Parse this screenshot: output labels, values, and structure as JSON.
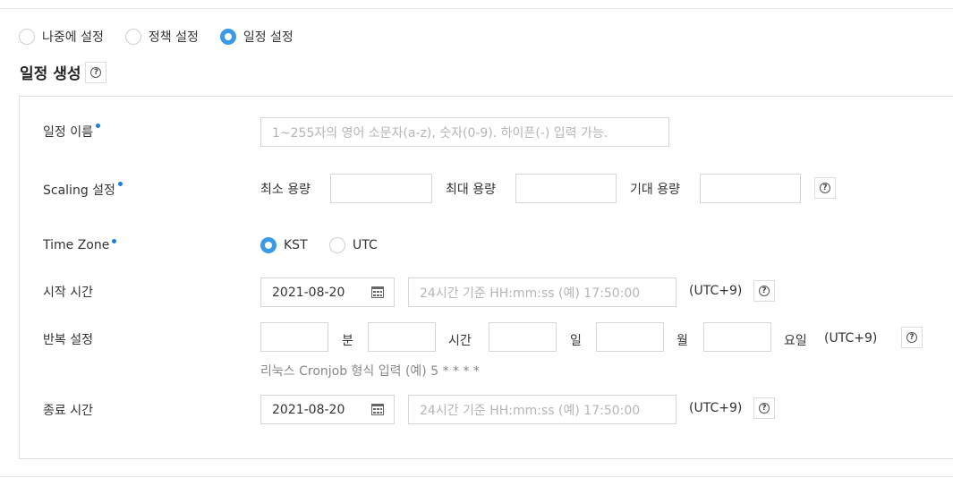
{
  "mode_options": [
    {
      "label": "나중에 설정",
      "selected": false
    },
    {
      "label": "정책 설정",
      "selected": false
    },
    {
      "label": "일정 설정",
      "selected": true
    }
  ],
  "section": {
    "title": "일정 생성"
  },
  "form": {
    "name": {
      "label": "일정 이름",
      "placeholder": "1~255자의 영어 소문자(a-z), 숫자(0-9). 하이픈(-) 입력 가능."
    },
    "scaling": {
      "label": "Scaling 설정",
      "min_label": "최소 용량",
      "max_label": "최대 용량",
      "desired_label": "기대 용량"
    },
    "timezone": {
      "label": "Time Zone",
      "options": [
        {
          "label": "KST",
          "selected": true
        },
        {
          "label": "UTC",
          "selected": false
        }
      ]
    },
    "start": {
      "label": "시작 시간",
      "date": "2021-08-20",
      "time_placeholder": "24시간 기준 HH:mm:ss (예) 17:50:00",
      "utc_note": "(UTC+9)"
    },
    "repeat": {
      "label": "반복 설정",
      "minute_label": "분",
      "hour_label": "시간",
      "day_label": "일",
      "month_label": "월",
      "weekday_label": "요일",
      "utc_note": "(UTC+9)",
      "hint": "리눅스 Cronjob 형식 입력 (예) 5 * * * *"
    },
    "end": {
      "label": "종료 시간",
      "date": "2021-08-20",
      "time_placeholder": "24시간 기준 HH:mm:ss (예) 17:50:00",
      "utc_note": "(UTC+9)"
    }
  },
  "colors": {
    "accent": "#3a9ae8",
    "required_dot": "#1e7be0",
    "border": "#d6d6d6"
  }
}
